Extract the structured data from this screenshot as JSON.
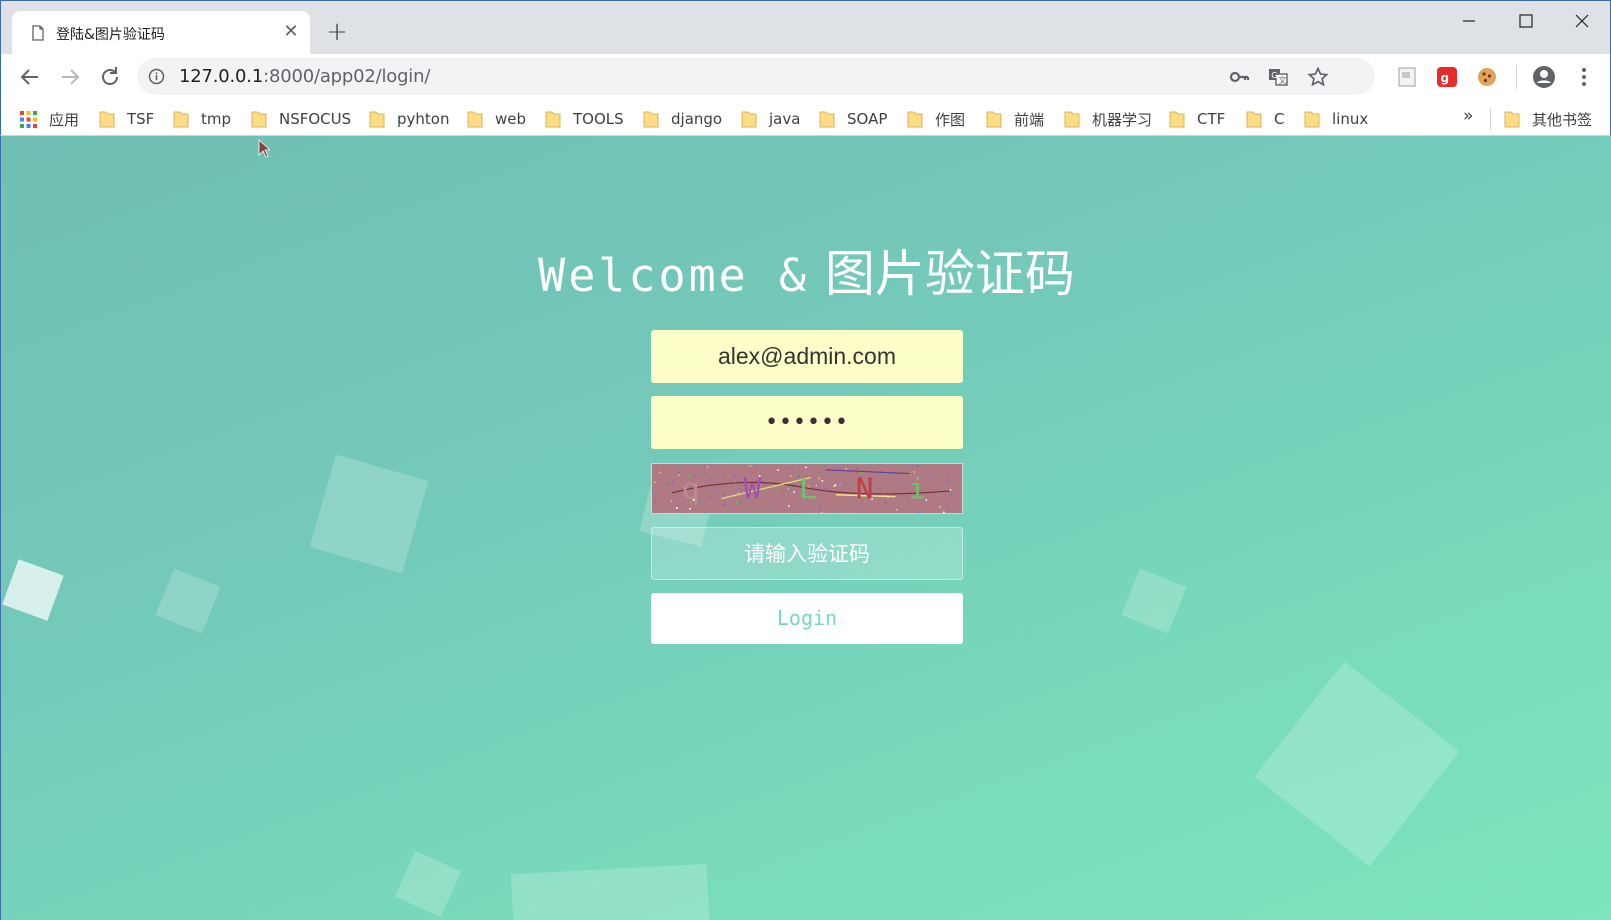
{
  "browser": {
    "tab_title": "登陆&图片验证码",
    "address": {
      "host": "127.0.0.1",
      "port_path": ":8000/app02/login/"
    }
  },
  "bookmarks": [
    {
      "label": "应用",
      "kind": "apps"
    },
    {
      "label": "TSF",
      "kind": "folder"
    },
    {
      "label": "tmp",
      "kind": "folder"
    },
    {
      "label": "NSFOCUS",
      "kind": "folder"
    },
    {
      "label": "pyhton",
      "kind": "folder"
    },
    {
      "label": "web",
      "kind": "folder"
    },
    {
      "label": "TOOLS",
      "kind": "folder"
    },
    {
      "label": "django",
      "kind": "folder"
    },
    {
      "label": "java",
      "kind": "folder"
    },
    {
      "label": "SOAP",
      "kind": "folder"
    },
    {
      "label": "作图",
      "kind": "folder"
    },
    {
      "label": "前端",
      "kind": "folder"
    },
    {
      "label": "机器学习",
      "kind": "folder"
    },
    {
      "label": "CTF",
      "kind": "folder"
    },
    {
      "label": "C",
      "kind": "folder"
    },
    {
      "label": "linux",
      "kind": "folder"
    }
  ],
  "bookmarks_more": "»",
  "other_bookmarks": "其他书签",
  "page": {
    "heading_latin": "Welcome &",
    "heading_cjk": "图片验证码",
    "email_value": "alex@admin.com",
    "password_value": "••••••",
    "captcha_text": [
      "q",
      "W",
      "L",
      "N",
      "i"
    ],
    "code_placeholder": "请输入验证码",
    "login_label": "Login"
  },
  "colors": {
    "tab_strip": "#dee1e6",
    "input_fill": "#fcffc8",
    "page_gradient_start": "#6fbfb3",
    "page_gradient_end": "#7ce5bd",
    "login_text": "#79d8bd"
  }
}
